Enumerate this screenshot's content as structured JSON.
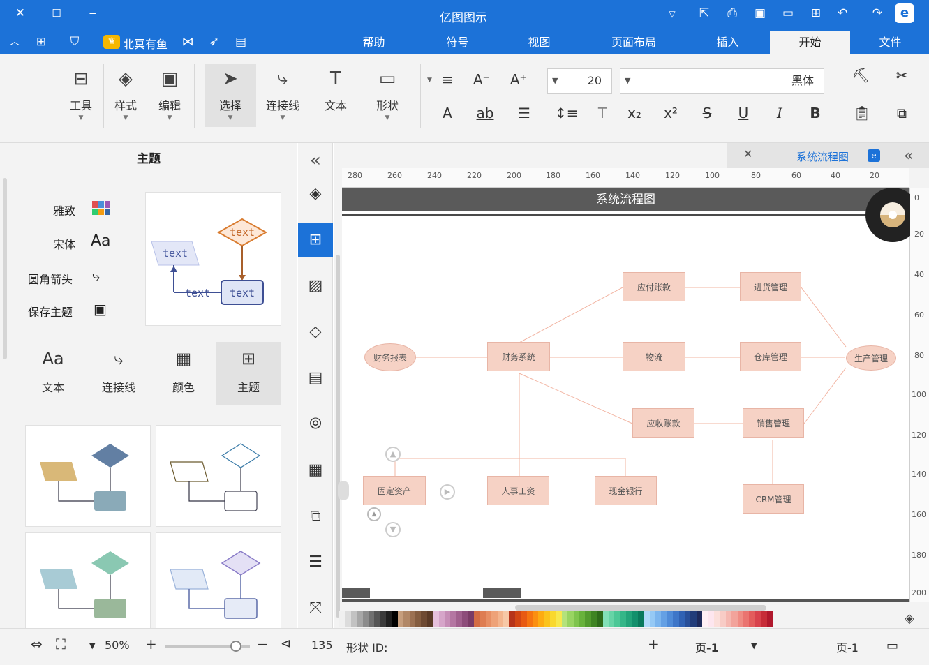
{
  "app": {
    "title": "亿图图示",
    "brand_color": "#1c72d8"
  },
  "titlebar": {
    "left_controls": [
      "close-icon",
      "maximize-icon",
      "minimize-icon"
    ],
    "quick_icons": [
      "chevron-down-icon",
      "redo-icon",
      "undo-icon",
      "new-icon",
      "open-icon",
      "save-icon",
      "print-icon",
      "export-icon",
      "more-icon"
    ],
    "account_label": "北冥有鱼",
    "second_row_icons": [
      "collapse-icon",
      "apps-icon",
      "shirt-icon",
      "crown-icon",
      "share-icon",
      "pointer-icon",
      "feedback-icon"
    ]
  },
  "menu": {
    "tabs": [
      "文件",
      "开始",
      "插入",
      "页面布局",
      "视图",
      "符号",
      "帮助"
    ],
    "active": "开始"
  },
  "ribbon": {
    "font_name": "黑体",
    "font_size": "20",
    "buttons": {
      "shape": "形状",
      "text": "文本",
      "connector": "连接线",
      "select": "选择",
      "edit": "编辑",
      "style": "样式",
      "tools": "工具"
    },
    "small_icons_row1": [
      "cut-icon",
      "format-painter-icon",
      "font-grow-icon",
      "font-shrink-icon",
      "align-icon"
    ],
    "small_icons_row2": [
      "copy-icon",
      "paste-icon",
      "bold-icon",
      "italic-icon",
      "underline-icon",
      "strike-icon",
      "superscript-icon",
      "subscript-icon",
      "text-effect-icon",
      "line-spacing-icon",
      "list-icon",
      "highlight-icon",
      "font-color-icon"
    ]
  },
  "left_panel": {
    "title": "主题",
    "theme_options": [
      {
        "label": "雅致",
        "icon": "palette-grid-icon"
      },
      {
        "label": "宋体",
        "icon": "font-aa-icon"
      },
      {
        "label": "圆角箭头",
        "icon": "rounded-connector-icon"
      },
      {
        "label": "保存主题",
        "icon": "save-theme-icon"
      }
    ],
    "preview_text": "text",
    "tabs": [
      {
        "label": "主题",
        "icon": "theme-grid-icon",
        "active": true
      },
      {
        "label": "颜色",
        "icon": "color-grid-icon",
        "active": false
      },
      {
        "label": "连接线",
        "icon": "connector-icon",
        "active": false
      },
      {
        "label": "文本",
        "icon": "text-aa-icon",
        "active": false
      }
    ],
    "theme_cards": [
      {
        "diamond": "#627fa3",
        "para": "#d9b878",
        "rect": "#8aaab8"
      },
      {
        "diamond": "#ffffff",
        "para": "#ffffff",
        "rect": "#ffffff"
      },
      {
        "diamond": "#8ac8b2",
        "para": "#a8cbd5",
        "rect": "#9ab89a"
      },
      {
        "diamond": "#e4e0f5",
        "para": "#e2eaf7",
        "rect": "#e6ebf7"
      }
    ]
  },
  "vertical_toolbar": [
    "fill-icon",
    "theme-grid-icon",
    "image-icon",
    "layers-icon",
    "page-icon",
    "chart-icon",
    "table-icon",
    "puzzle-icon",
    "gantt-icon",
    "mindmap-icon"
  ],
  "document": {
    "tab_label": "系统流程图",
    "page_title": "系统流程图",
    "ruler_h": [
      "20",
      "40",
      "60",
      "80",
      "100",
      "120",
      "140",
      "160",
      "180",
      "200",
      "220",
      "240",
      "260",
      "280"
    ],
    "ruler_v": [
      "0",
      "20",
      "40",
      "60",
      "80",
      "100",
      "120",
      "140",
      "160",
      "180",
      "200"
    ],
    "nodes": {
      "production": "生产管理",
      "purchase": "进货管理",
      "payable": "应付账款",
      "warehouse": "仓库管理",
      "logistics": "物流",
      "finance_system": "财务系统",
      "finance_report": "财务报表",
      "sales": "销售管理",
      "receivable": "应收账款",
      "crm": "CRM管理",
      "cash_bank": "现金银行",
      "payroll": "人事工资",
      "fixed_assets": "固定资产"
    }
  },
  "palette_colors": [
    "#b0182c",
    "#c72c38",
    "#d8424c",
    "#e35c5c",
    "#ea7470",
    "#ef8c84",
    "#f2a39b",
    "#f5b8b1",
    "#f8ccc6",
    "#fbdfdb",
    "#fde6ef",
    "#fff0f5",
    "#1e2a5a",
    "#223d7a",
    "#284f99",
    "#3062b4",
    "#3e76c8",
    "#4f8bd8",
    "#64a0e4",
    "#7bb5ee",
    "#95c9f5",
    "#b0daf9",
    "#0a7a5c",
    "#13906c",
    "#22a47a",
    "#34b688",
    "#4cc796",
    "#66d4a6",
    "#82e0b7",
    "#2e6b1a",
    "#3f8423",
    "#529b2d",
    "#68b23b",
    "#7fc44d",
    "#99d462",
    "#b4e27b",
    "#f7e84d",
    "#f9d82e",
    "#fbc31c",
    "#fdab12",
    "#fb8f10",
    "#f57410",
    "#e85a12",
    "#d24614",
    "#b6341a",
    "#f7c8a6",
    "#f3b58e",
    "#eea278",
    "#e78f64",
    "#de7d52",
    "#d46c44",
    "#7a3b66",
    "#8d4c7a",
    "#a1608e",
    "#b476a2",
    "#c68db6",
    "#d6a5c9",
    "#e6c0db",
    "#5a3a26",
    "#6e4a32",
    "#845d40",
    "#9b7152",
    "#b18766",
    "#c69e7d",
    "#000000",
    "#1f1f1f",
    "#3a3a3a",
    "#555555",
    "#707070",
    "#8c8c8c",
    "#a7a7a7",
    "#c2c2c2",
    "#dcdcdc",
    "#f0f0f0"
  ],
  "status": {
    "page_label": "页-1",
    "page_tab": "页-1",
    "shape_id_label": "形状 ID:",
    "shape_id": "135",
    "zoom": "50%"
  }
}
